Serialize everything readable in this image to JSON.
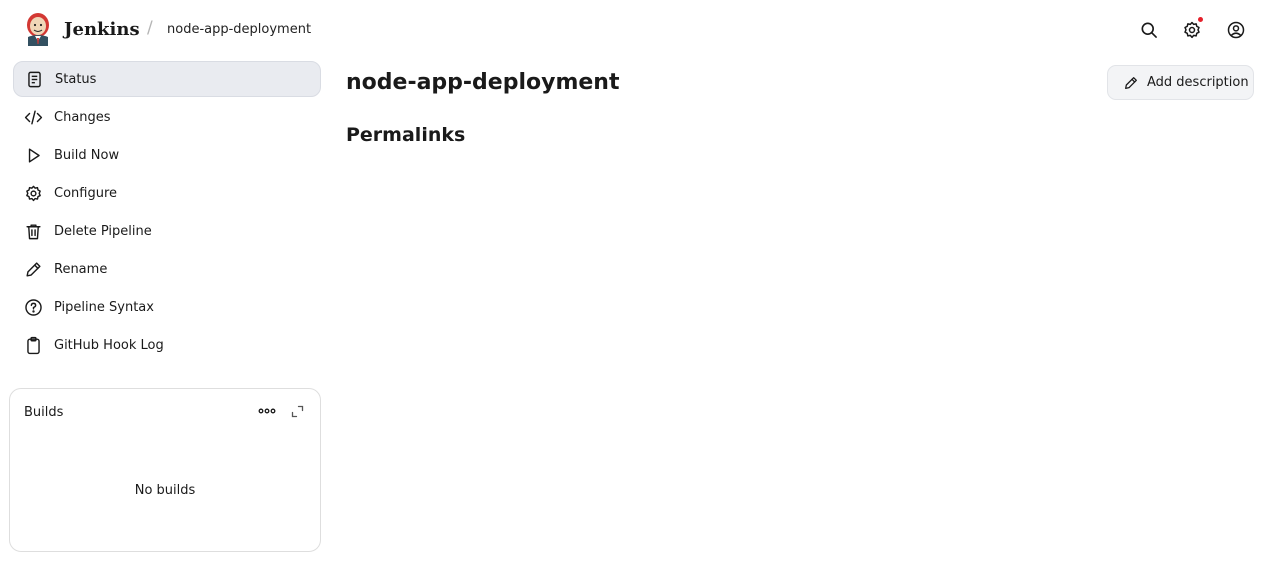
{
  "header": {
    "app_name": "Jenkins",
    "breadcrumb_separator": "/",
    "breadcrumb_item": "node-app-deployment",
    "actions": {
      "search_icon": "search-icon",
      "settings_icon": "gear-icon",
      "account_icon": "user-icon"
    },
    "notification_color": "#e5202b"
  },
  "sidebar": {
    "items": [
      {
        "label": "Status",
        "icon": "document-icon",
        "active": true
      },
      {
        "label": "Changes",
        "icon": "code-icon"
      },
      {
        "label": "Build Now",
        "icon": "play-icon"
      },
      {
        "label": "Configure",
        "icon": "gear-icon"
      },
      {
        "label": "Delete Pipeline",
        "icon": "trash-icon"
      },
      {
        "label": "Rename",
        "icon": "pencil-icon"
      },
      {
        "label": "Pipeline Syntax",
        "icon": "help-circle-icon"
      },
      {
        "label": "GitHub Hook Log",
        "icon": "clipboard-icon"
      }
    ]
  },
  "builds": {
    "title": "Builds",
    "empty_text": "No builds"
  },
  "main": {
    "title": "node-app-deployment",
    "permalinks_heading": "Permalinks",
    "add_description_label": "Add description"
  }
}
